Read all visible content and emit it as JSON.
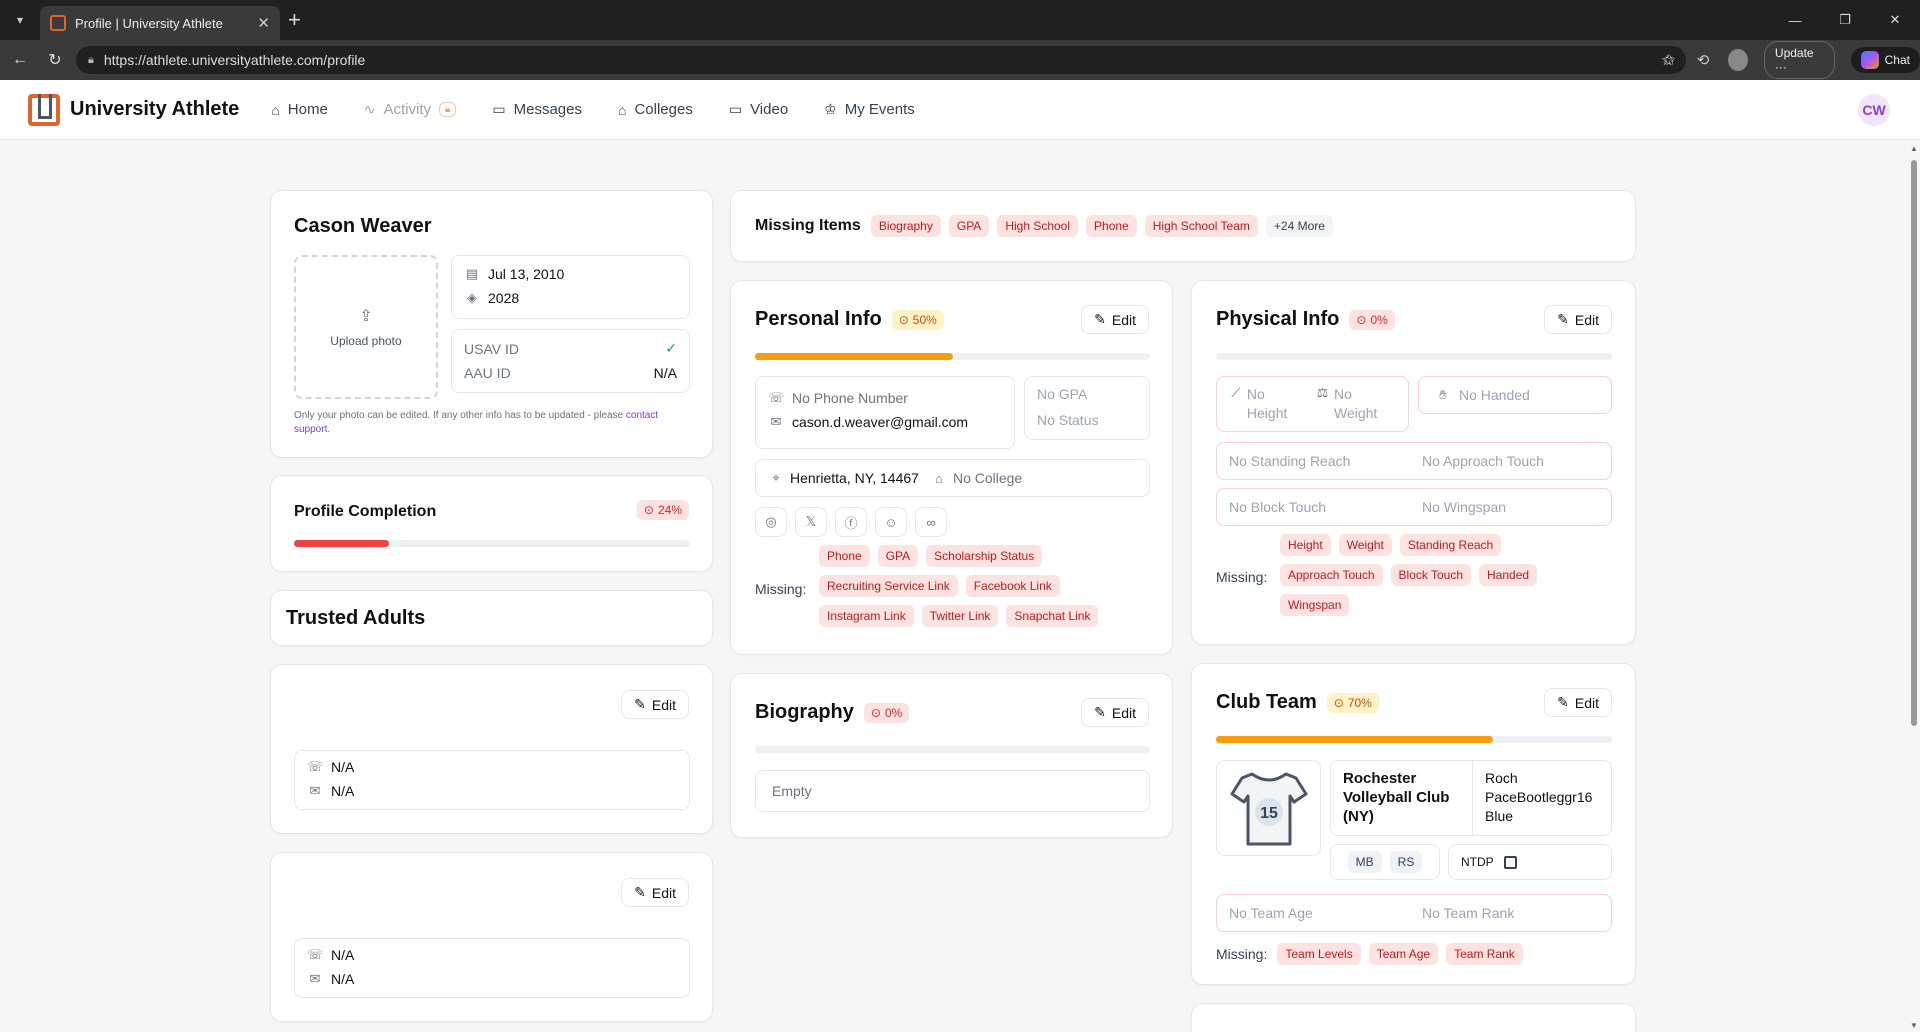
{
  "browser": {
    "tab_title": "Profile | University Athlete",
    "url": "https://athlete.universityathlete.com/profile",
    "update_label": "Update",
    "chat_label": "Chat"
  },
  "nav": {
    "brand": "University Athlete",
    "items": [
      {
        "label": "Home",
        "icon": "home-icon"
      },
      {
        "label": "Activity",
        "icon": "activity-icon"
      },
      {
        "label": "Messages",
        "icon": "message-icon"
      },
      {
        "label": "Colleges",
        "icon": "college-icon"
      },
      {
        "label": "Video",
        "icon": "video-icon"
      },
      {
        "label": "My Events",
        "icon": "trophy-icon"
      }
    ],
    "user_initials": "CW"
  },
  "athlete": {
    "name": "Cason Weaver",
    "upload_label": "Upload photo",
    "birthdate": "Jul 13, 2010",
    "grad_year": "2028",
    "usav_label": "USAV ID",
    "aau_label": "AAU ID",
    "aau_value": "N/A",
    "note": "Only your photo can be edited. If any other info has to be updated - please",
    "note_link": "contact support",
    "note_end": "."
  },
  "completion": {
    "title": "Profile Completion",
    "percent_label": "24%",
    "percent": 24,
    "color": "#ef4444"
  },
  "trusted": {
    "title": "Trusted Adults",
    "edit_label": "Edit",
    "adults": [
      {
        "phone": "N/A",
        "email": "N/A"
      },
      {
        "phone": "N/A",
        "email": "N/A"
      }
    ]
  },
  "missing": {
    "title": "Missing Items",
    "items": [
      "Biography",
      "GPA",
      "High School",
      "Phone",
      "High School Team"
    ],
    "more": "+24 More"
  },
  "personal": {
    "title": "Personal Info",
    "percent_label": "50%",
    "percent": 50,
    "color": "#f59e0b",
    "edit_label": "Edit",
    "phone": "No Phone Number",
    "email": "cason.d.weaver@gmail.com",
    "gpa": "No GPA",
    "status": "No Status",
    "location": "Henrietta, NY, 14467",
    "college": "No College",
    "missing_label": "Missing:",
    "missing_rows": [
      [
        "Phone",
        "GPA",
        "Scholarship Status"
      ],
      [
        "Recruiting Service Link",
        "Facebook Link"
      ],
      [
        "Instagram Link",
        "Twitter Link",
        "Snapchat Link"
      ]
    ]
  },
  "biography": {
    "title": "Biography",
    "percent_label": "0%",
    "edit_label": "Edit",
    "text": "Empty"
  },
  "physical": {
    "title": "Physical Info",
    "percent_label": "0%",
    "edit_label": "Edit",
    "height": "No Height",
    "weight": "No Weight",
    "handed": "No Handed",
    "standing_reach": "No Standing Reach",
    "approach_touch": "No Approach Touch",
    "block_touch": "No Block Touch",
    "wingspan": "No Wingspan",
    "missing_label": "Missing:",
    "missing_rows": [
      [
        "Height",
        "Weight",
        "Standing Reach"
      ],
      [
        "Approach Touch",
        "Block Touch",
        "Handed"
      ],
      [
        "Wingspan"
      ]
    ]
  },
  "club": {
    "title": "Club Team",
    "percent_label": "70%",
    "percent": 70,
    "color": "#f59e0b",
    "edit_label": "Edit",
    "jersey_number": "15",
    "club_name": "Rochester Volleyball Club (NY)",
    "team_line1": "Roch",
    "team_line2": "PaceBootleggr16",
    "team_line3": "Blue",
    "positions": [
      "MB",
      "RS"
    ],
    "ntdp_label": "NTDP",
    "team_age": "No Team Age",
    "team_rank": "No Team Rank",
    "missing_label": "Missing:",
    "missing": [
      "Team Levels",
      "Team Age",
      "Team Rank"
    ]
  }
}
